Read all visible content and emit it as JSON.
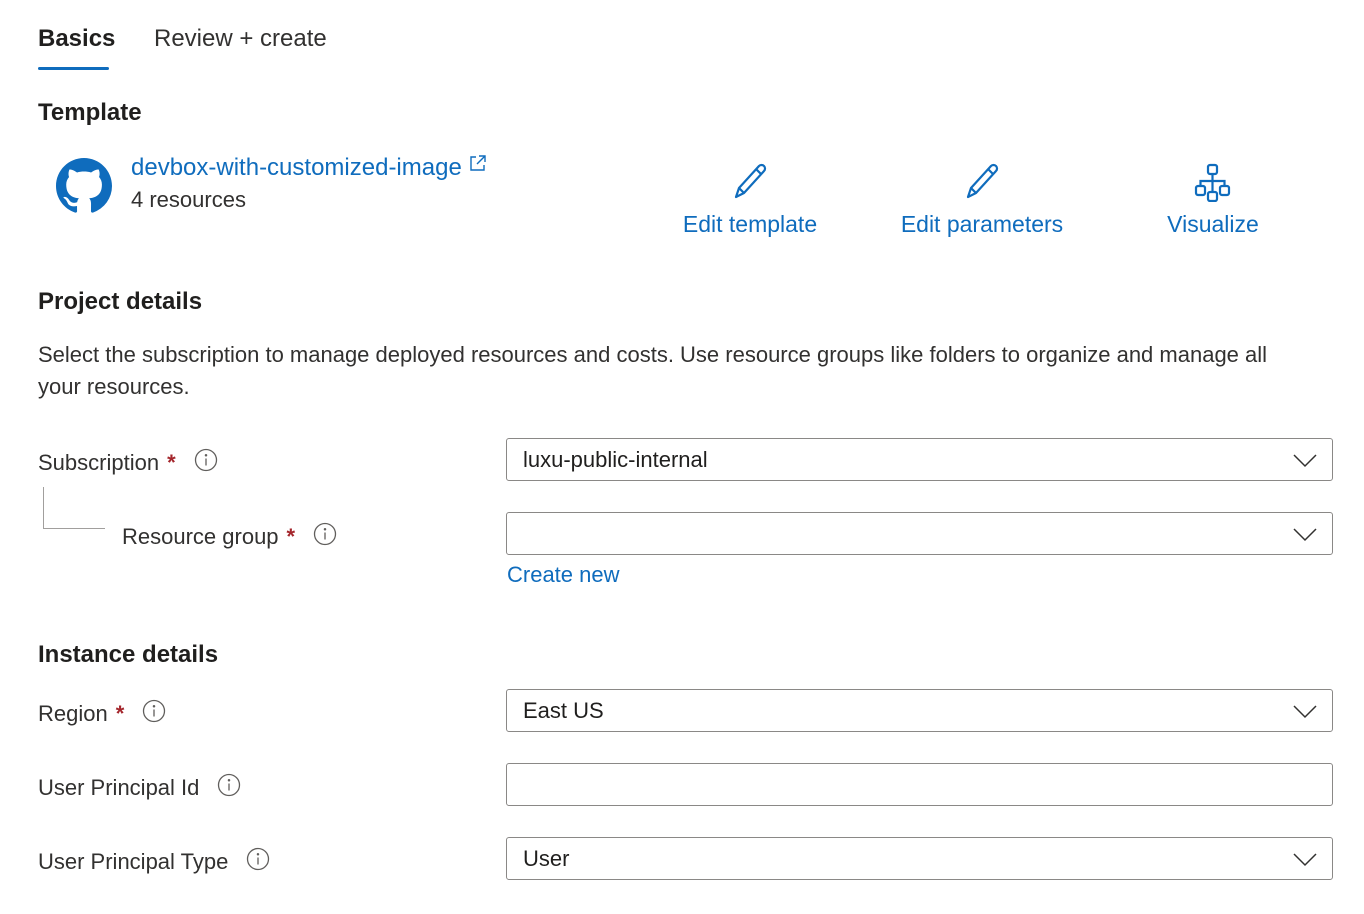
{
  "tabs": [
    {
      "label": "Basics",
      "active": true
    },
    {
      "label": "Review + create",
      "active": false
    }
  ],
  "template": {
    "section_title": "Template",
    "name": "devbox-with-customized-image",
    "resources": "4 resources",
    "actions": [
      {
        "label": "Edit template",
        "icon": "pencil-icon"
      },
      {
        "label": "Edit parameters",
        "icon": "pencil-icon"
      },
      {
        "label": "Visualize",
        "icon": "hierarchy-icon"
      }
    ]
  },
  "project_details": {
    "section_title": "Project details",
    "description": "Select the subscription to manage deployed resources and costs. Use resource groups like folders to organize and manage all your resources.",
    "subscription": {
      "label": "Subscription",
      "required": "*",
      "value": "luxu-public-internal"
    },
    "resource_group": {
      "label": "Resource group",
      "required": "*",
      "value": "",
      "create_new": "Create new"
    }
  },
  "instance_details": {
    "section_title": "Instance details",
    "region": {
      "label": "Region",
      "required": "*",
      "value": "East US"
    },
    "user_principal_id": {
      "label": "User Principal Id",
      "value": ""
    },
    "user_principal_type": {
      "label": "User Principal Type",
      "value": "User"
    }
  },
  "colors": {
    "accent": "#0f6cbd",
    "required": "#a4262c",
    "border": "#8a8886"
  }
}
